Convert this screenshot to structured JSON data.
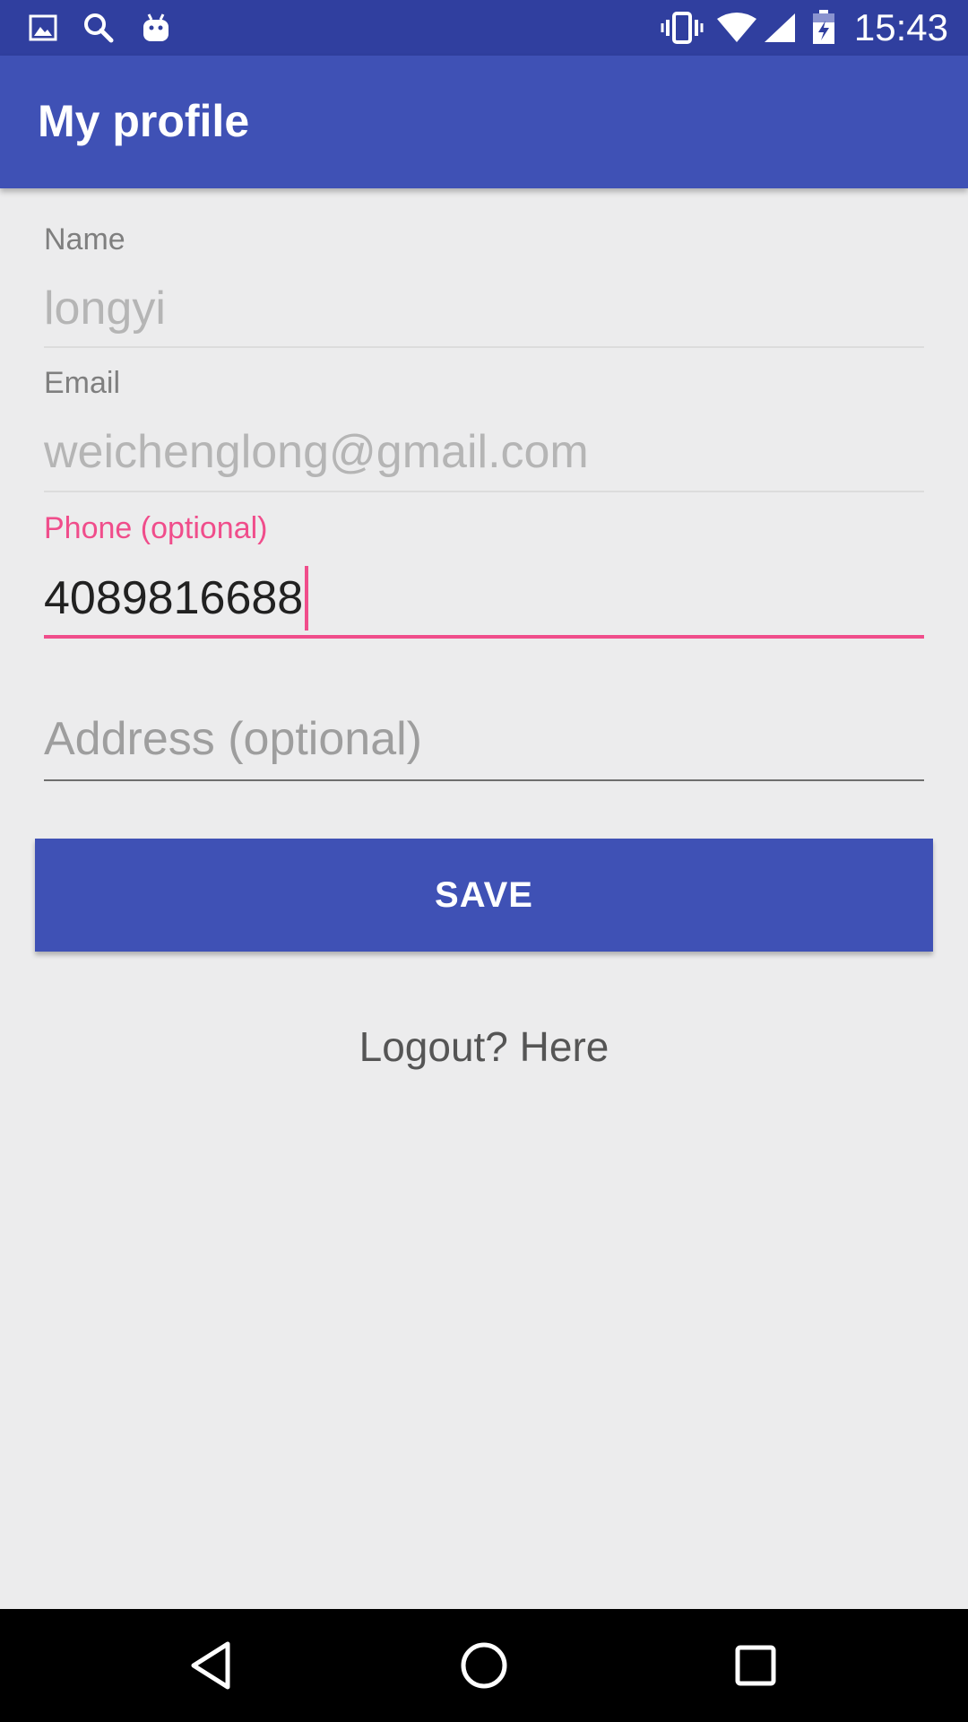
{
  "status_bar": {
    "time": "15:43",
    "left_icons": [
      "gallery-icon",
      "search-icon",
      "android-icon"
    ],
    "right_icons": [
      "vibrate-icon",
      "wifi-icon",
      "signal-icon",
      "battery-charging-icon"
    ]
  },
  "app_bar": {
    "title": "My profile"
  },
  "form": {
    "name": {
      "label": "Name",
      "value": "longyi"
    },
    "email": {
      "label": "Email",
      "value": "weichenglong@gmail.com"
    },
    "phone": {
      "label": "Phone (optional)",
      "value": "4089816688"
    },
    "address": {
      "placeholder": "Address (optional)"
    },
    "save_label": "SAVE",
    "logout_text": "Logout? Here"
  },
  "colors": {
    "primary": "#3f51b5",
    "primary_dark": "#303f9f",
    "accent": "#f04d8b",
    "background": "#ececed"
  },
  "nav_bar": {
    "buttons": [
      "back-icon",
      "home-icon",
      "recents-icon"
    ]
  }
}
